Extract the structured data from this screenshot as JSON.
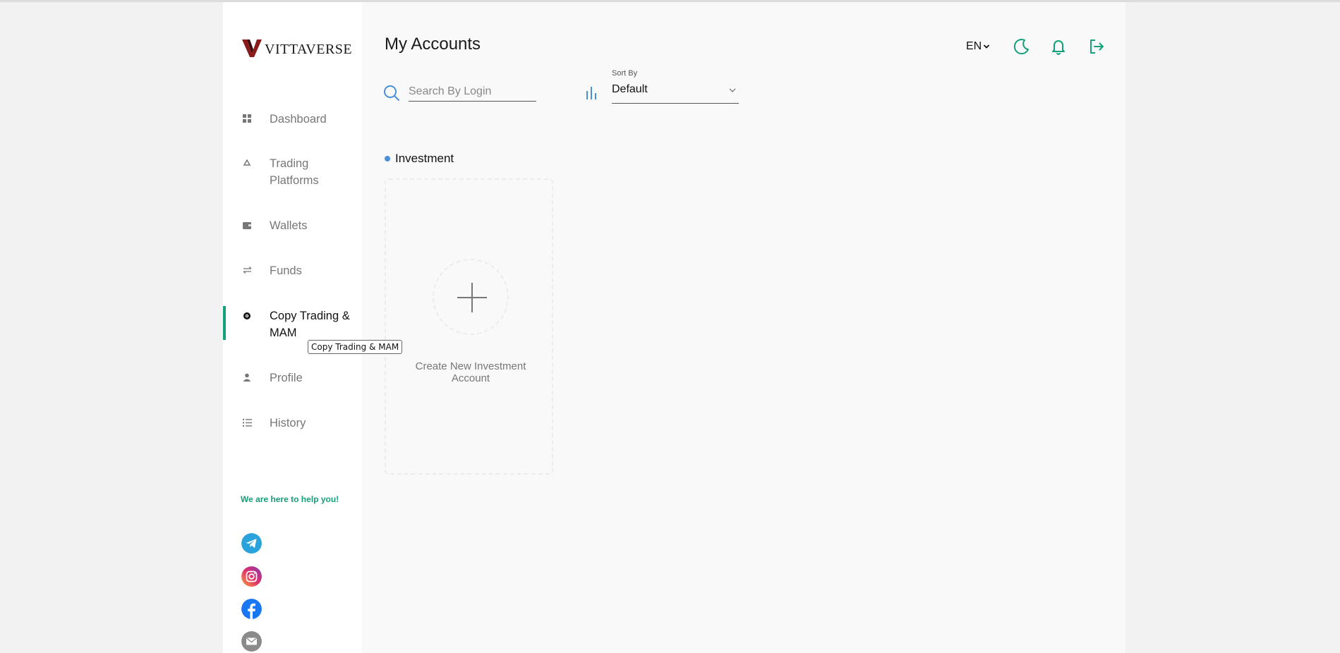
{
  "app": {
    "logo_text": "VITTAVERSE",
    "accent_color": "#14a07a"
  },
  "sidebar": {
    "items": [
      {
        "label": "Dashboard",
        "icon": "dashboard-grid-icon"
      },
      {
        "label": "Trading Platforms",
        "icon": "recycle-icon"
      },
      {
        "label": "Wallets",
        "icon": "wallet-icon"
      },
      {
        "label": "Funds",
        "icon": "transfer-arrows-icon"
      },
      {
        "label": "Copy Trading & MAM",
        "icon": "copy-trading-icon",
        "active": true
      },
      {
        "label": "Profile",
        "icon": "user-icon"
      },
      {
        "label": "History",
        "icon": "list-icon"
      }
    ],
    "help_text": "We are here to help you!",
    "social": [
      "telegram-icon",
      "instagram-icon",
      "facebook-icon",
      "email-icon"
    ]
  },
  "tooltip": {
    "text": "Copy Trading & MAM"
  },
  "header": {
    "title": "My Accounts",
    "language": "EN"
  },
  "search": {
    "placeholder": "Search By Login",
    "value": ""
  },
  "sort": {
    "label": "Sort By",
    "value": "Default"
  },
  "investment": {
    "section_title": "Investment",
    "create_label": "Create New Investment Account"
  }
}
